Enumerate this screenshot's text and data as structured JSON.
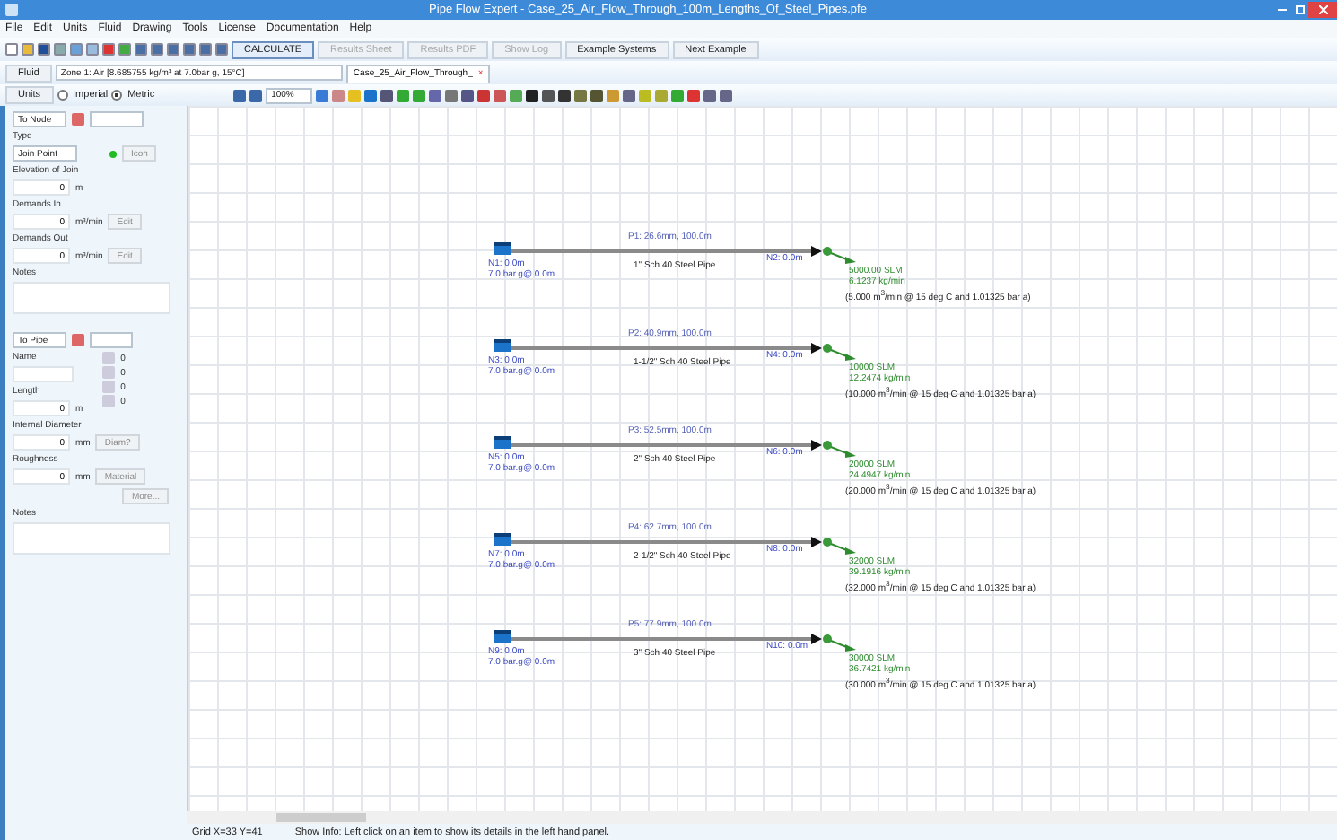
{
  "window": {
    "title": "Pipe Flow Expert - Case_25_Air_Flow_Through_100m_Lengths_Of_Steel_Pipes.pfe"
  },
  "menu": [
    "File",
    "Edit",
    "Units",
    "Fluid",
    "Drawing",
    "Tools",
    "License",
    "Documentation",
    "Help"
  ],
  "toolbar_buttons": [
    {
      "label": "CALCULATE",
      "disabled": false
    },
    {
      "label": "Results Sheet",
      "disabled": true
    },
    {
      "label": "Results PDF",
      "disabled": true
    },
    {
      "label": "Show Log",
      "disabled": true
    },
    {
      "label": "Example Systems",
      "disabled": false
    },
    {
      "label": "Next Example",
      "disabled": false
    }
  ],
  "fluid": {
    "button": "Fluid",
    "zone": "Zone 1: Air [8.685755 kg/m³ at 7.0bar g, 15°C]",
    "tab": "Case_25_Air_Flow_Through_",
    "tab_close": "×"
  },
  "units": {
    "button": "Units",
    "options": [
      {
        "label": "Imperial",
        "selected": false
      },
      {
        "label": "Metric",
        "selected": true
      }
    ],
    "zoom": "100%"
  },
  "node_panel": {
    "selector": "To Node",
    "type_label": "Type",
    "type_value": "Join Point",
    "icon_button": "Icon",
    "elevation_label": "Elevation of Join",
    "elevation_value": "0",
    "elevation_unit": "m",
    "demands_in_label": "Demands In",
    "demands_in_value": "0",
    "demands_in_unit": "m³/min",
    "demands_in_button": "Edit",
    "demands_out_label": "Demands Out",
    "demands_out_value": "0",
    "demands_out_unit": "m³/min",
    "demands_out_button": "Edit",
    "notes_label": "Notes"
  },
  "pipe_panel": {
    "selector": "To Pipe",
    "name_label": "Name",
    "fitting_counts": [
      "0",
      "0",
      "0",
      "0"
    ],
    "length_label": "Length",
    "length_value": "0",
    "length_unit": "m",
    "diameter_label": "Internal Diameter",
    "diameter_value": "0",
    "diameter_unit": "mm",
    "diameter_button": "Diam?",
    "roughness_label": "Roughness",
    "roughness_value": "0",
    "roughness_unit": "mm",
    "roughness_button": "Material",
    "more_button": "More...",
    "notes_label": "Notes"
  },
  "pipes": [
    {
      "label": "P1: 26.6mm, 100.0m",
      "start_node": [
        "N1: 0.0m",
        "7.0 bar.g@ 0.0m"
      ],
      "description": "1\" Sch 40 Steel Pipe",
      "end_node": "N2: 0.0m",
      "results": [
        "5000.00 SLM",
        "6.1237 kg/min",
        "(5.000 m$^{3}$/min @ 15 deg C and 1.01325 bar a)"
      ]
    },
    {
      "label": "P2: 40.9mm, 100.0m",
      "start_node": [
        "N3: 0.0m",
        "7.0 bar.g@ 0.0m"
      ],
      "description": "1-1/2\" Sch 40 Steel Pipe",
      "end_node": "N4: 0.0m",
      "results": [
        "10000 SLM",
        "12.2474 kg/min",
        "(10.000 m$^{3}$/min @ 15 deg C and 1.01325 bar a)"
      ]
    },
    {
      "label": "P3: 52.5mm, 100.0m",
      "start_node": [
        "N5: 0.0m",
        "7.0 bar.g@ 0.0m"
      ],
      "description": "2\" Sch 40 Steel Pipe",
      "end_node": "N6: 0.0m",
      "results": [
        "20000 SLM",
        "24.4947 kg/min",
        "(20.000 m$^{3}$/min @ 15 deg C and 1.01325 bar a)"
      ]
    },
    {
      "label": "P4: 62.7mm, 100.0m",
      "start_node": [
        "N7: 0.0m",
        "7.0 bar.g@ 0.0m"
      ],
      "description": "2-1/2\" Sch 40 Steel Pipe",
      "end_node": "N8: 0.0m",
      "results": [
        "32000 SLM",
        "39.1916 kg/min",
        "(32.000 m$^{3}$/min @ 15 deg C and 1.01325 bar a)"
      ]
    },
    {
      "label": "P5: 77.9mm, 100.0m",
      "start_node": [
        "N9: 0.0m",
        "7.0 bar.g@ 0.0m"
      ],
      "description": "3\" Sch 40 Steel Pipe",
      "end_node": "N10: 0.0m",
      "results": [
        "30000 SLM",
        "36.7421 kg/min",
        "(30.000 m$^{3}$/min @ 15 deg C and 1.01325 bar a)"
      ]
    }
  ],
  "status_bar": {
    "grid": "Grid X=33 Y=41",
    "info": "Show Info: Left click on an item to show its details in the left hand panel."
  }
}
